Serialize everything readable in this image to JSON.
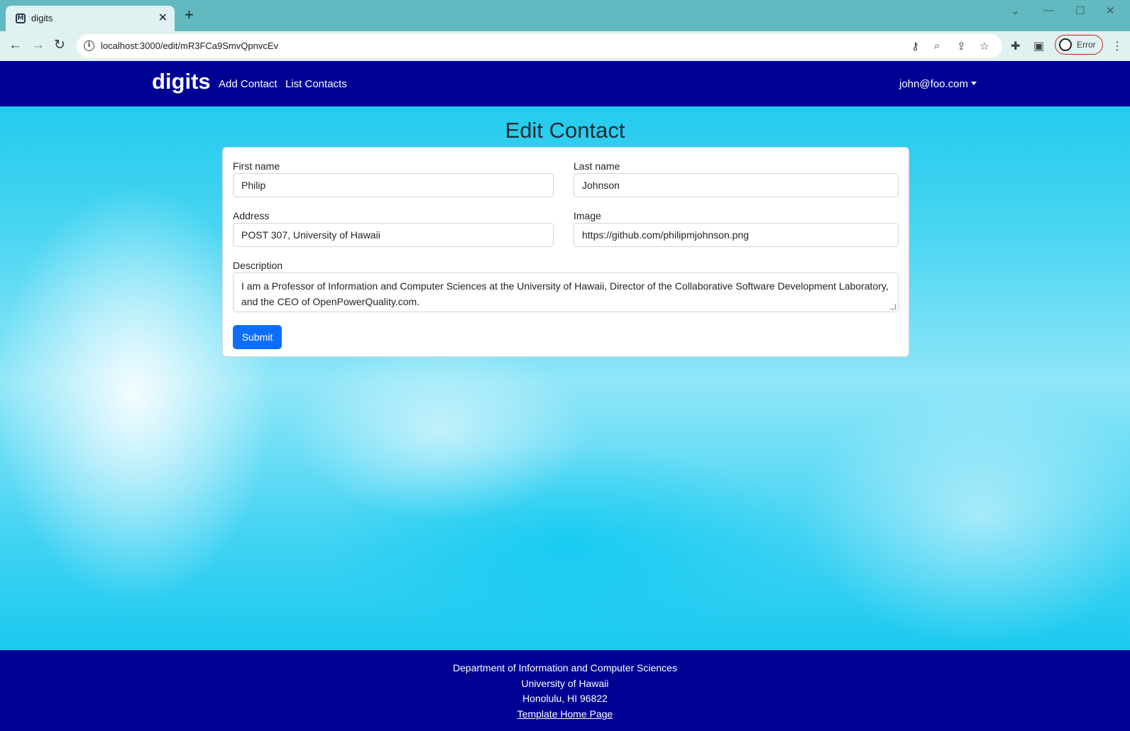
{
  "browser": {
    "tab_title": "digits",
    "favicon_glyph": "M",
    "url": "localhost:3000/edit/mR3FCa9SmvQpnvcEv",
    "profile_status": "Error"
  },
  "navbar": {
    "brand": "digits",
    "links": [
      "Add Contact",
      "List Contacts"
    ],
    "user": "john@foo.com"
  },
  "page_title": "Edit Contact",
  "form": {
    "first_name_label": "First name",
    "first_name_value": "Philip",
    "last_name_label": "Last name",
    "last_name_value": "Johnson",
    "address_label": "Address",
    "address_value": "POST 307, University of Hawaii",
    "image_label": "Image",
    "image_value": "https://github.com/philipmjohnson.png",
    "description_label": "Description",
    "description_value": "I am a Professor of Information and Computer Sciences at the University of Hawaii, Director of the Collaborative Software Development Laboratory, and the CEO of OpenPowerQuality.com.",
    "submit_label": "Submit"
  },
  "footer": {
    "line1": "Department of Information and Computer Sciences",
    "line2": "University of Hawaii",
    "line3": "Honolulu, HI 96822",
    "link": "Template Home Page"
  },
  "colors": {
    "navbar": "#000093",
    "submit": "#0d6efd",
    "page_bg": "#16c7ec"
  }
}
